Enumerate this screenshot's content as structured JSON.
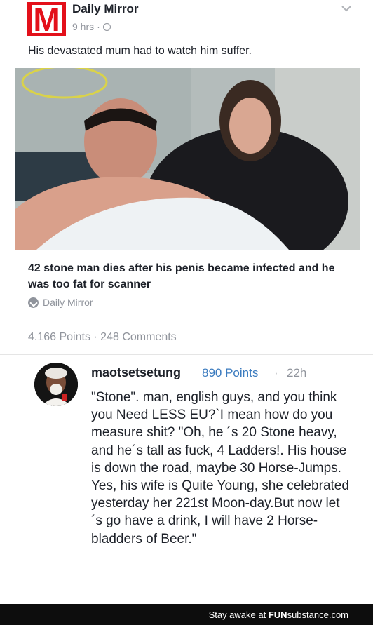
{
  "post": {
    "page_name": "Daily Mirror",
    "logo_letter": "M",
    "time_ago": "9 hrs",
    "meta_sep": "·",
    "caption": "His devastated mum had to watch him suffer.",
    "link_title": "42 stone man dies after his penis became infected and he was too fat for scanner",
    "link_source": "Daily Mirror",
    "stats": "4.166 Points · 248 Comments"
  },
  "comment": {
    "username": "maotsetsetung",
    "points": "890 Points",
    "sep": "·",
    "time": "22h",
    "text": "\"Stone\". man, english guys, and you think you Need LESS EU?`I mean how do you measure shit? \"Oh, he ´s 20 Stone heavy, and he´s tall as fuck, 4 Ladders!. His house is down the road, maybe 30 Horse-Jumps. Yes, his wife is Quite Young, she celebrated yesterday her 221st Moon-day.But now let´s go have a drink, I will have 2 Horse-bladders of Beer.\""
  },
  "footer": {
    "text_prefix": "Stay awake at ",
    "brand_fun": "FUN",
    "brand_sub": "substance",
    "brand_suffix": ".com"
  },
  "icons": {
    "globe": "globe-icon",
    "chevron": "chevron-down-icon",
    "source": "source-check-icon"
  },
  "colors": {
    "brand_red": "#e3101a",
    "link_blue": "#3b7bbf",
    "meta_gray": "#90949c"
  }
}
